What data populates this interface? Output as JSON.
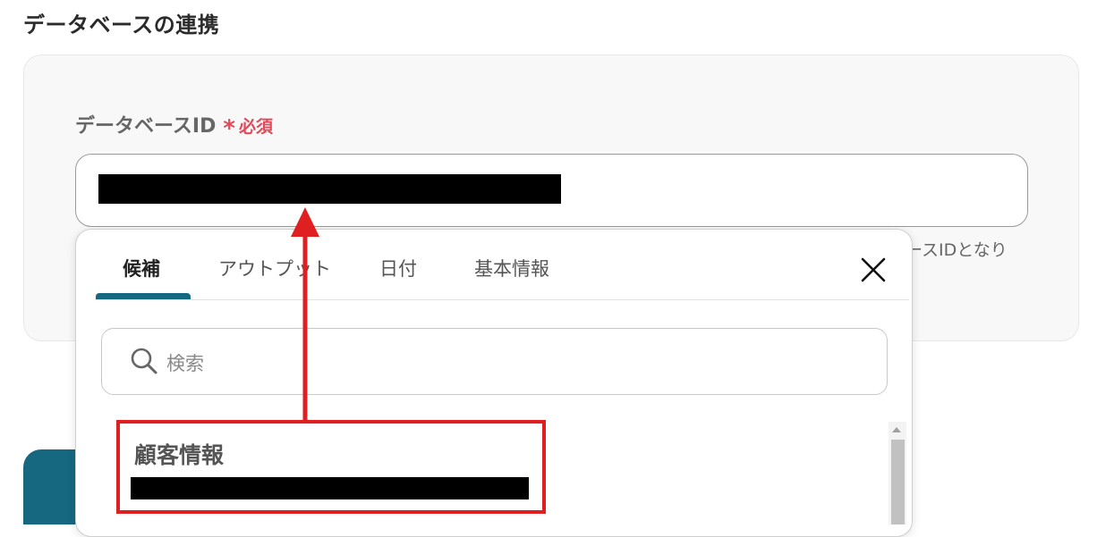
{
  "section": {
    "title": "データベースの連携"
  },
  "field": {
    "label": "データベースID",
    "required_mark": "*",
    "required_text": "必須",
    "help_text_fragment": "ースIDとなり"
  },
  "popup": {
    "tabs": [
      {
        "label": "候補",
        "active": true
      },
      {
        "label": "アウトプット",
        "active": false
      },
      {
        "label": "日付",
        "active": false
      },
      {
        "label": "基本情報",
        "active": false
      }
    ],
    "close_icon": "close-icon",
    "search": {
      "placeholder": "検索",
      "icon": "search-icon"
    },
    "candidates": [
      {
        "title": "顧客情報",
        "highlighted": true
      }
    ]
  },
  "colors": {
    "accent": "#15687f",
    "required": "#e24a5a",
    "annotation": "#e02020"
  }
}
